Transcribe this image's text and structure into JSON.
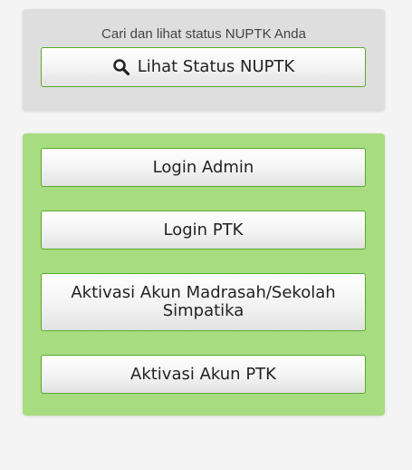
{
  "status_panel": {
    "hint": "Cari dan lihat status NUPTK Anda",
    "button_label": "Lihat Status NUPTK",
    "button_icon": "search-icon"
  },
  "login_panel": {
    "buttons": [
      {
        "label": "Login Admin"
      },
      {
        "label": "Login PTK"
      },
      {
        "label": "Aktivasi Akun Madrasah/Sekolah Simpatika"
      },
      {
        "label": "Aktivasi Akun PTK"
      }
    ]
  },
  "colors": {
    "page_background": "#f4f4f4",
    "status_panel_background": "#dedede",
    "login_panel_background": "#a8dc80",
    "button_border": "#5aaa2e"
  }
}
